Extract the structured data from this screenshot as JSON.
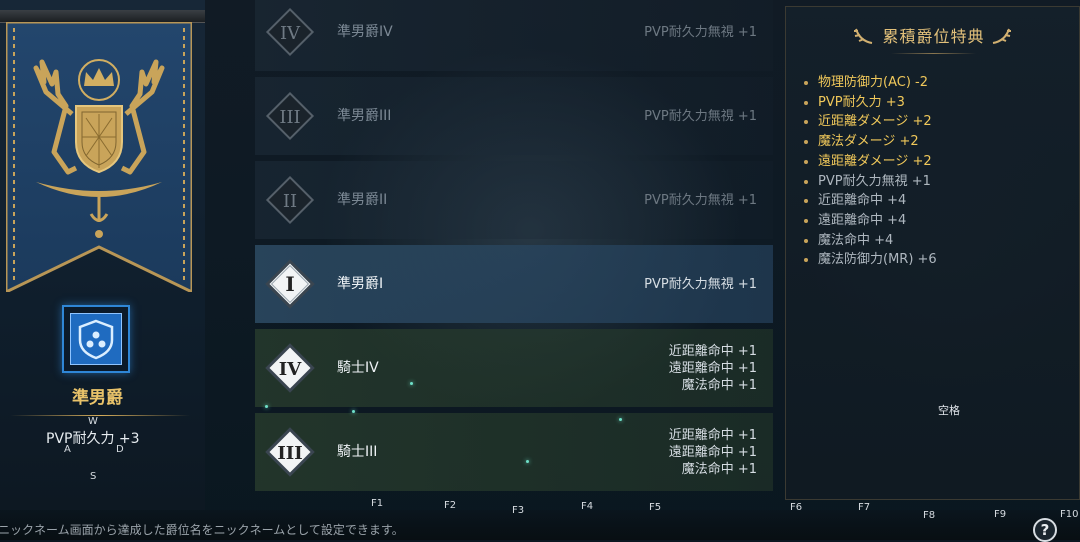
{
  "left_panel": {
    "rank_name": "準男爵",
    "rank_bonus": "PVP耐久力 +3",
    "key_hints": {
      "w": "W",
      "a": "A",
      "d": "D",
      "s": "S"
    }
  },
  "ranks": [
    {
      "numeral": "IV",
      "name": "準男爵IV",
      "bonus": [
        "PVP耐久力無視 +1"
      ],
      "state": "locked"
    },
    {
      "numeral": "III",
      "name": "準男爵III",
      "bonus": [
        "PVP耐久力無視 +1"
      ],
      "state": "locked"
    },
    {
      "numeral": "II",
      "name": "準男爵II",
      "bonus": [
        "PVP耐久力無視 +1"
      ],
      "state": "locked"
    },
    {
      "numeral": "I",
      "name": "準男爵I",
      "bonus": [
        "PVP耐久力無視 +1"
      ],
      "state": "current"
    },
    {
      "numeral": "IV",
      "name": "騎士IV",
      "bonus": [
        "近距離命中 +1",
        "遠距離命中 +1",
        "魔法命中 +1"
      ],
      "state": "achieved"
    },
    {
      "numeral": "III",
      "name": "騎士III",
      "bonus": [
        "近距離命中 +1",
        "遠距離命中 +1",
        "魔法命中 +1"
      ],
      "state": "achieved"
    }
  ],
  "cumulative": {
    "title": "累積爵位特典",
    "perks": [
      {
        "text": "物理防御力(AC) -2",
        "style": "gold"
      },
      {
        "text": "PVP耐久力 +3",
        "style": "gold"
      },
      {
        "text": "近距離ダメージ +2",
        "style": "gold"
      },
      {
        "text": "魔法ダメージ +2",
        "style": "gold"
      },
      {
        "text": "遠距離ダメージ +2",
        "style": "gold"
      },
      {
        "text": "PVP耐久力無視 +1",
        "style": "gray"
      },
      {
        "text": "近距離命中 +4",
        "style": "gray"
      },
      {
        "text": "遠距離命中 +4",
        "style": "gray"
      },
      {
        "text": "魔法命中 +4",
        "style": "gray"
      },
      {
        "text": "魔法防御力(MR) +6",
        "style": "gray"
      }
    ],
    "blank_key_label": "空格"
  },
  "bottom": {
    "hint_text": "ニックネーム画面から達成した爵位名をニックネームとして設定できます。",
    "fkeys": [
      "F1",
      "F2",
      "F3",
      "F4",
      "F5",
      "F6",
      "F7",
      "F8",
      "F9",
      "F10"
    ],
    "help_label": "?"
  },
  "colors": {
    "gold": "#f0c85a",
    "current_row": "#2d4b64",
    "achieved_row": "#283c2d",
    "icon_blue": "#1f6bc0"
  }
}
